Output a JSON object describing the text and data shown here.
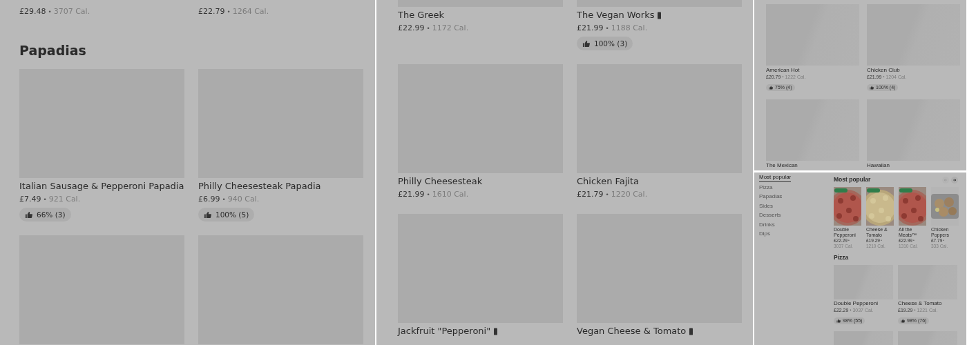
{
  "panels": [
    {
      "kind": "menu",
      "blocks": [
        {
          "kind": "row",
          "items": [
            {
              "price": "£29.48",
              "separator": "•",
              "calories": "3707 Cal."
            },
            {
              "price": "£22.79",
              "separator": "•",
              "calories": "1264 Cal."
            }
          ]
        },
        {
          "kind": "heading",
          "text": "Papadias"
        },
        {
          "kind": "row",
          "items": [
            {
              "image": true,
              "name": "Italian Sausage & Pepperoni Papadia",
              "vegan": false,
              "price": "£7.49",
              "separator": "•",
              "calories": "921 Cal.",
              "rating": "66% (3)"
            },
            {
              "image": true,
              "name": "Philly Cheesesteak Papadia",
              "vegan": false,
              "price": "£6.99",
              "separator": "•",
              "calories": "940 Cal.",
              "rating": "100% (5)"
            }
          ]
        },
        {
          "kind": "row",
          "items": [
            {
              "image": true
            },
            {
              "image": true
            }
          ]
        }
      ]
    },
    {
      "kind": "menu",
      "blocks": [
        {
          "kind": "row",
          "items": [
            {
              "image": true,
              "name": "The Greek",
              "vegan": false,
              "price": "£22.99",
              "separator": "•",
              "calories": "1172 Cal."
            },
            {
              "image": true,
              "name": "The Vegan Works",
              "vegan": true,
              "price": "£21.99",
              "separator": "•",
              "calories": "1188 Cal.",
              "rating": "100% (3)"
            }
          ]
        },
        {
          "kind": "row",
          "items": [
            {
              "image": true,
              "name": "Philly Cheesesteak",
              "vegan": false,
              "price": "£21.99",
              "separator": "•",
              "calories": "1610 Cal."
            },
            {
              "image": true,
              "name": "Chicken Fajita",
              "vegan": false,
              "price": "£21.79",
              "separator": "•",
              "calories": "1220 Cal."
            }
          ]
        },
        {
          "kind": "row",
          "items": [
            {
              "image": true,
              "name": "Jackfruit \"Pepperoni\"",
              "vegan": true
            },
            {
              "image": true,
              "name": "Vegan Cheese & Tomato",
              "vegan": true
            }
          ]
        }
      ]
    },
    {
      "kind": "menu",
      "blocks": [
        {
          "kind": "row",
          "items": [
            {
              "image": true,
              "name": "American Hot",
              "vegan": false,
              "price": "£20.79",
              "separator": "•",
              "calories": "1222 Cal.",
              "rating": "75% (4)"
            },
            {
              "image": true,
              "name": "Chicken Club",
              "vegan": false,
              "price": "£21.99",
              "separator": "•",
              "calories": "1204 Cal.",
              "rating": "100% (4)"
            }
          ]
        },
        {
          "kind": "row",
          "items": [
            {
              "image": true,
              "name": "The Mexican",
              "vegan": false
            },
            {
              "image": true,
              "name": "Hawaiian",
              "vegan": false
            }
          ]
        }
      ]
    },
    {
      "kind": "store",
      "categories": [
        {
          "label": "Most popular",
          "selected": true
        },
        {
          "label": "Pizza",
          "selected": false
        },
        {
          "label": "Papadias",
          "selected": false
        },
        {
          "label": "Sides",
          "selected": false
        },
        {
          "label": "Desserts",
          "selected": false
        },
        {
          "label": "Drinks",
          "selected": false
        },
        {
          "label": "Dips",
          "selected": false
        }
      ],
      "heading": "Most popular",
      "nav": [
        {
          "disabled": true
        },
        {
          "disabled": false
        }
      ],
      "carousel": [
        {
          "name": "Double Pepperoni",
          "badge": true,
          "price": "£22.29",
          "separator": "•",
          "calories": "3037 Cal."
        },
        {
          "name": "Cheese & Tomato",
          "badge": true,
          "price": "£19.29",
          "separator": "•",
          "calories": "1210 Cal."
        },
        {
          "name": "All the Meats™",
          "badge": true,
          "price": "£22.99",
          "separator": "•",
          "calories": "1310 Cal."
        },
        {
          "name": "Chicken Poppers",
          "badge": false,
          "price": "£7.79",
          "separator": "•",
          "calories": "333 Cal."
        }
      ],
      "blocks": [
        {
          "kind": "heading",
          "text": "Pizza"
        },
        {
          "kind": "row",
          "items": [
            {
              "image": true,
              "name": "Double Pepperoni",
              "vegan": false,
              "price": "£22.29",
              "separator": "•",
              "calories": "3037 Cal.",
              "rating": "98% (55)"
            },
            {
              "image": true,
              "name": "Cheese & Tomato",
              "vegan": false,
              "price": "£19.29",
              "separator": "•",
              "calories": "1221 Cal.",
              "rating": "98% (76)"
            }
          ]
        },
        {
          "kind": "row",
          "items": [
            {
              "image": true
            },
            {
              "image": true
            }
          ]
        }
      ]
    }
  ]
}
